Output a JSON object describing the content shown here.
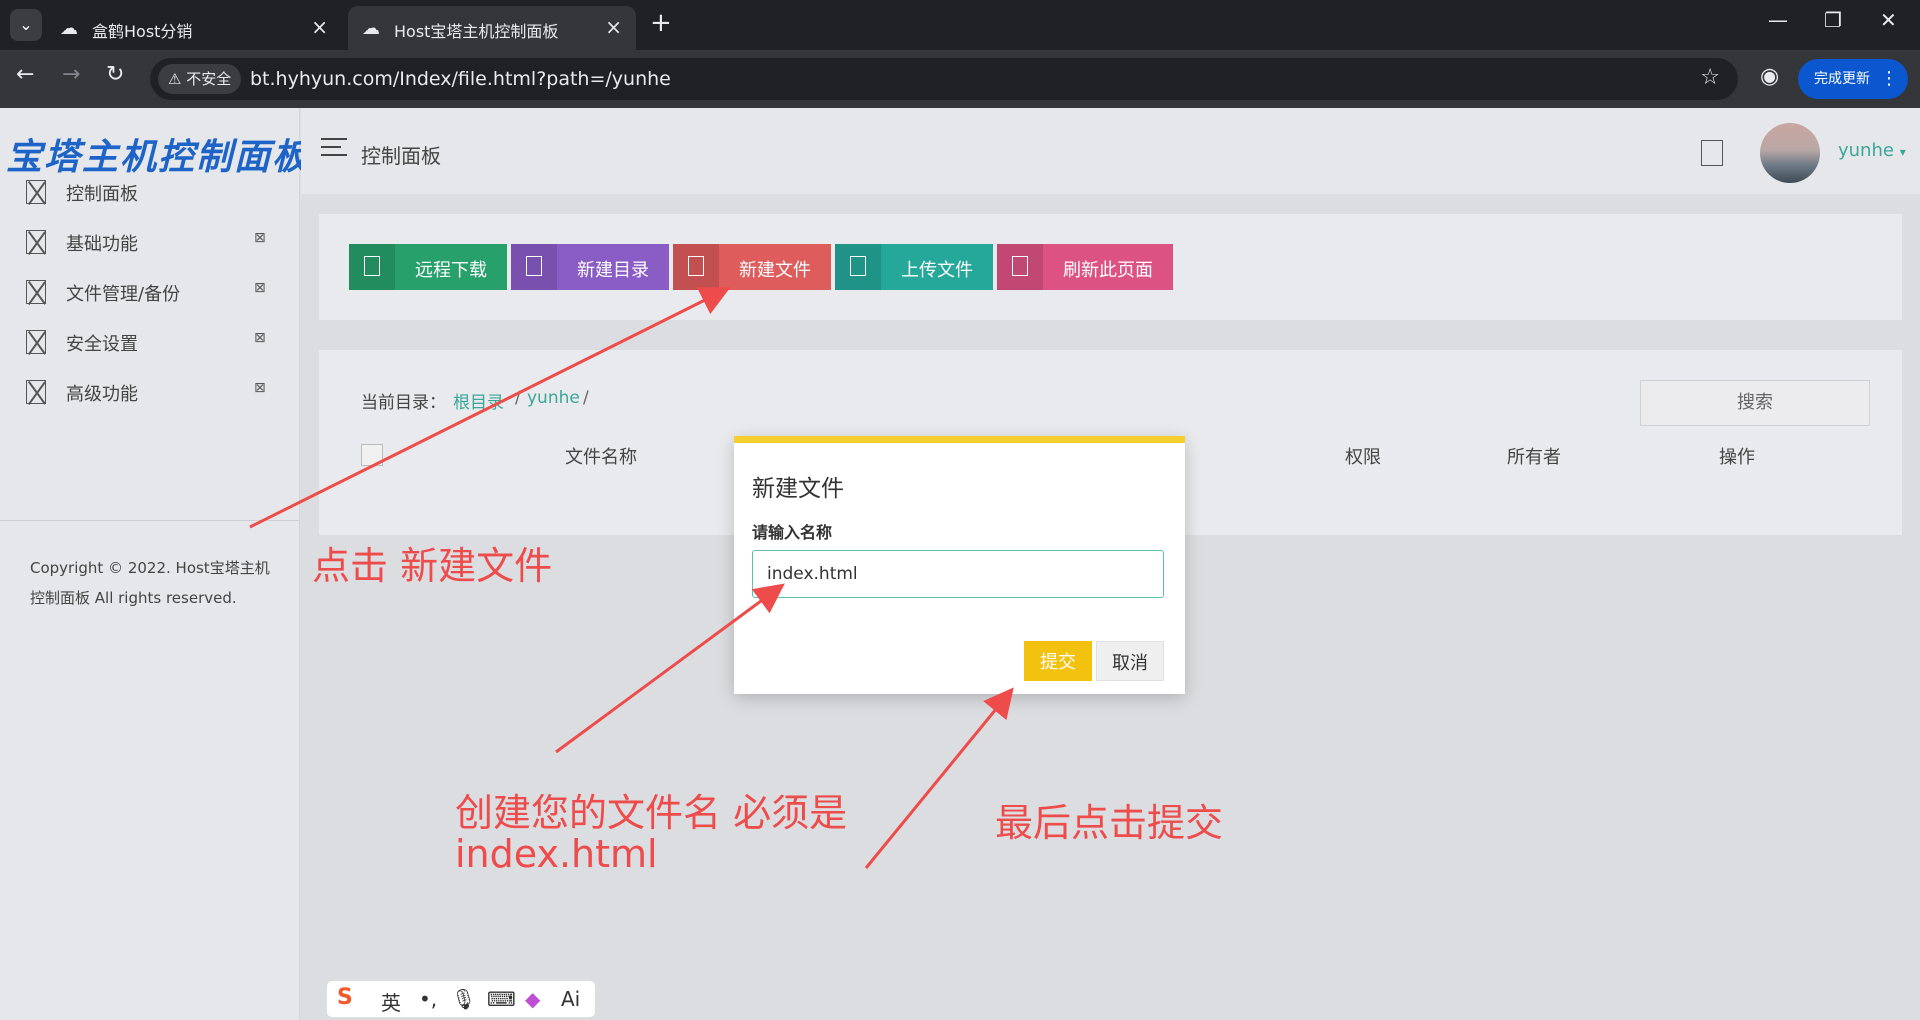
{
  "browser": {
    "tabs": [
      {
        "label": "盒鹤Host分销",
        "active": false
      },
      {
        "label": "Host宝塔主机控制面板",
        "active": true
      }
    ],
    "security_label": "不安全",
    "url": "bt.hyhyun.com/Index/file.html?path=/yunhe",
    "update_button": "完成更新"
  },
  "sidebar": {
    "brand": "宝塔主机控制面板",
    "items": [
      {
        "label": "控制面板",
        "has_arrow": false
      },
      {
        "label": "基础功能",
        "has_arrow": true
      },
      {
        "label": "文件管理/备份",
        "has_arrow": true
      },
      {
        "label": "安全设置",
        "has_arrow": true
      },
      {
        "label": "高级功能",
        "has_arrow": true
      }
    ],
    "copyright": "Copyright © 2022. Host宝塔主机控制面板 All rights reserved."
  },
  "header": {
    "title": "控制面板",
    "username": "yunhe"
  },
  "actions": [
    {
      "label": "远程下载",
      "color": "#27a06c"
    },
    {
      "label": "新建目录",
      "color": "#8a5cc6"
    },
    {
      "label": "新建文件",
      "color": "#de5c5c"
    },
    {
      "label": "上传文件",
      "color": "#25a89a"
    },
    {
      "label": "刷新此页面",
      "color": "#dc5283"
    }
  ],
  "file_panel": {
    "current_dir_label": "当前目录：",
    "crumbs": [
      "根目录",
      "yunhe"
    ],
    "search_placeholder": "搜索",
    "columns": [
      "文件名称",
      "权限",
      "所有者",
      "操作"
    ]
  },
  "modal": {
    "title": "新建文件",
    "field_label": "请输入名称",
    "field_value": "index.html",
    "submit": "提交",
    "cancel": "取消",
    "accent": "#f5cd2c"
  },
  "annotations": {
    "step1": "点击 新建文件",
    "step2_line1": "创建您的文件名 必须是",
    "step2_line2": "index.html",
    "step3": "最后点击提交",
    "color": "#ee4b4b"
  },
  "ime": {
    "lang": "英",
    "ai": "Ai"
  }
}
